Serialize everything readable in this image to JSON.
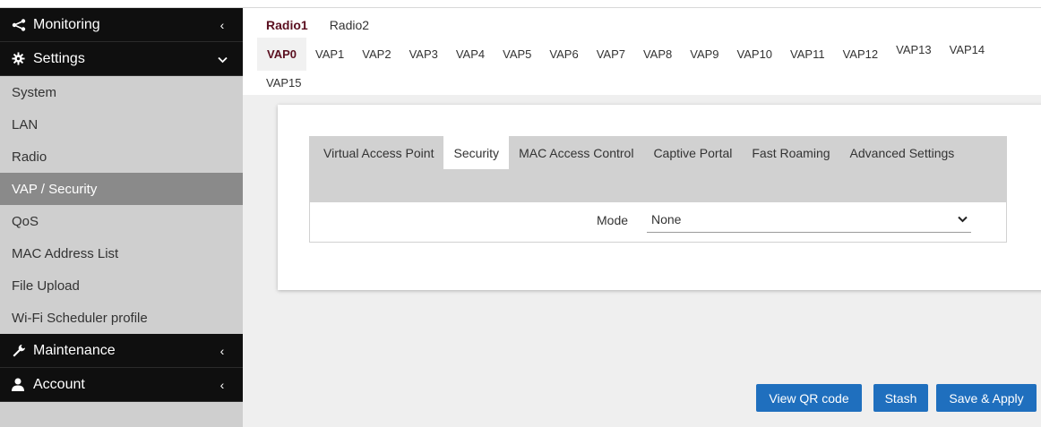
{
  "sidebar": {
    "monitoring": {
      "label": "Monitoring",
      "icon": "share-icon"
    },
    "settings": {
      "label": "Settings",
      "icon": "gear-icon"
    },
    "items": [
      {
        "label": "System"
      },
      {
        "label": "LAN"
      },
      {
        "label": "Radio"
      },
      {
        "label": "VAP / Security",
        "active": true
      },
      {
        "label": "QoS"
      },
      {
        "label": "MAC Address List"
      },
      {
        "label": "File Upload"
      },
      {
        "label": "Wi-Fi Scheduler profile"
      }
    ],
    "maintenance": {
      "label": "Maintenance",
      "icon": "wrench-icon"
    },
    "account": {
      "label": "Account",
      "icon": "user-icon"
    }
  },
  "radio_tabs": [
    "Radio1",
    "Radio2"
  ],
  "vap_tabs": [
    "VAP0",
    "VAP1",
    "VAP2",
    "VAP3",
    "VAP4",
    "VAP5",
    "VAP6",
    "VAP7",
    "VAP8",
    "VAP9",
    "VAP10",
    "VAP11",
    "VAP12",
    "VAP13",
    "VAP14",
    "VAP15"
  ],
  "sub_tabs": [
    "Virtual Access Point",
    "Security",
    "MAC Access Control",
    "Captive Portal",
    "Fast Roaming",
    "Advanced Settings"
  ],
  "mode": {
    "label": "Mode",
    "value": "None"
  },
  "buttons": {
    "qr": "View QR code",
    "stash": "Stash",
    "save": "Save & Apply"
  },
  "colors": {
    "accent": "#1f6fbe",
    "active_tab_text": "#5b1020",
    "sidebar_dark": "#0f0f0f"
  }
}
